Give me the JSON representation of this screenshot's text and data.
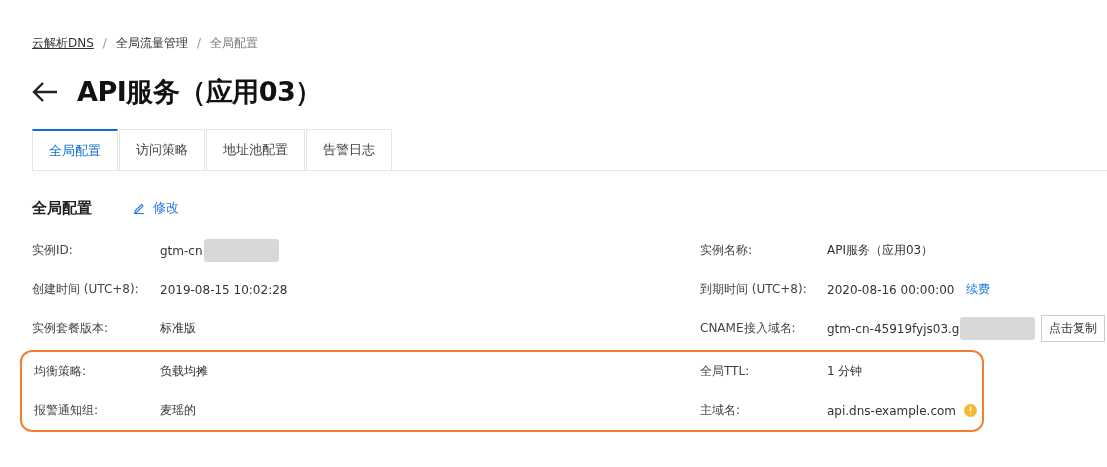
{
  "breadcrumb": [
    {
      "label": "云解析DNS",
      "kind": "link"
    },
    {
      "label": "全局流量管理",
      "kind": "link"
    },
    {
      "label": "全局配置",
      "kind": "current"
    }
  ],
  "breadcrumb_separator": "/",
  "title": "API服务（应用03）",
  "tabs": [
    {
      "label": "全局配置",
      "selected": true
    },
    {
      "label": "访问策略",
      "selected": false
    },
    {
      "label": "地址池配置",
      "selected": false
    },
    {
      "label": "告警日志",
      "selected": false
    }
  ],
  "section": {
    "title": "全局配置",
    "edit_label": "修改"
  },
  "rows": [
    {
      "highlighted": false,
      "fields": [
        {
          "label": "实例ID:",
          "value": "gtm-cn",
          "redacted": true
        },
        {
          "label": "实例名称:",
          "value": "API服务（应用03）"
        }
      ]
    },
    {
      "highlighted": false,
      "fields": [
        {
          "label": "创建时间 (UTC+8):",
          "value": "2019-08-15 10:02:28"
        },
        {
          "label": "到期时间 (UTC+8):",
          "value": "2020-08-16 00:00:00",
          "link": "续费"
        }
      ]
    },
    {
      "highlighted": false,
      "fields": [
        {
          "label": "实例套餐版本:",
          "value": "标准版"
        },
        {
          "label": "CNAME接入域名:",
          "value": "gtm-cn-45919fyjs03.g",
          "redacted": true,
          "button": "点击复制"
        }
      ]
    },
    {
      "highlighted": true,
      "fields": [
        {
          "label": "均衡策略:",
          "value": "负载均摊"
        },
        {
          "label": "全局TTL:",
          "value": "1 分钟"
        }
      ]
    },
    {
      "highlighted": true,
      "fields": [
        {
          "label": "报警通知组:",
          "value": "麦瑶的"
        },
        {
          "label": "主域名:",
          "value": "api.dns-example.com",
          "warning": true
        }
      ]
    }
  ]
}
